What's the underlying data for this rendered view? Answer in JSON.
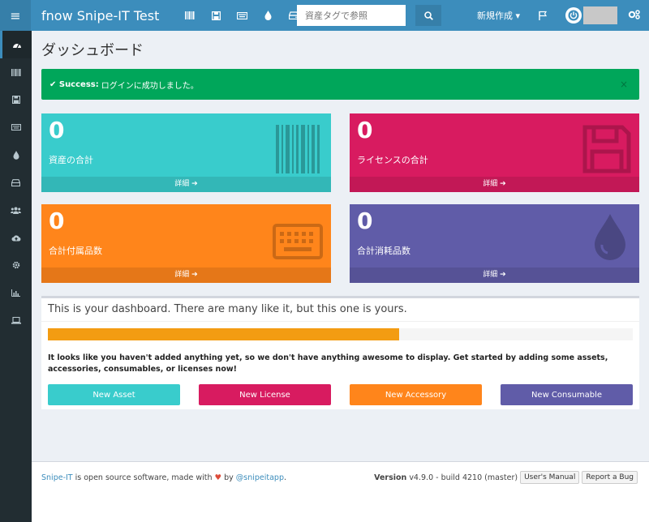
{
  "app": {
    "title": "fnow Snipe-IT Test"
  },
  "topnav": {
    "icons": [
      "barcode-icon",
      "floppy-icon",
      "keyboard-icon",
      "drop-icon",
      "hdd-icon"
    ],
    "search_placeholder": "資産タグで参照",
    "new_menu_label": "新規作成 ▾"
  },
  "page": {
    "title": "ダッシュボード"
  },
  "alert": {
    "strong": "✔ Success:",
    "message": "ログインに成功しました。",
    "close": "×"
  },
  "tiles": [
    {
      "count": "0",
      "label": "資産の合計",
      "more": "詳細 ➔",
      "color": "#39cccc",
      "icon": "barcode-icon"
    },
    {
      "count": "0",
      "label": "ライセンスの合計",
      "more": "詳細 ➔",
      "color": "#d81b60",
      "icon": "floppy-icon"
    },
    {
      "count": "0",
      "label": "合計付属品数",
      "more": "詳細 ➔",
      "color": "#ff851b",
      "icon": "keyboard-icon"
    },
    {
      "count": "0",
      "label": "合計消耗品数",
      "more": "詳細 ➔",
      "color": "#605ca8",
      "icon": "drop-icon"
    }
  ],
  "welcome": {
    "title": "This is your dashboard. There are many like it, but this one is yours.",
    "progress": 0.6,
    "message": "It looks like you haven't added anything yet, so we don't have anything awesome to display. Get started by adding some assets, accessories, consumables, or licenses now!",
    "buttons": [
      {
        "label": "New Asset",
        "color": "#39cccc"
      },
      {
        "label": "New License",
        "color": "#d81b60"
      },
      {
        "label": "New Accessory",
        "color": "#ff851b"
      },
      {
        "label": "New Consumable",
        "color": "#605ca8"
      }
    ]
  },
  "footer": {
    "product": "Snipe-IT",
    "text1": " is open source software, made with ",
    "heart": "♥",
    "text2": " by ",
    "handle": "@snipeitapp",
    "period": ".",
    "version_label": "Version",
    "version_value": " v4.9.0 - build 4210 (master)",
    "manual": "User's Manual",
    "bug": "Report a Bug"
  },
  "sidebar": {
    "items": [
      "dashboard-icon",
      "barcode-icon",
      "floppy-icon",
      "keyboard-icon",
      "drop-icon",
      "hdd-icon",
      "users-icon",
      "cloud-icon",
      "gear-icon",
      "chart-icon",
      "laptop-icon"
    ]
  },
  "colors": {
    "topbar": "#3c8dbc",
    "sidebar": "#222d32",
    "success": "#00a65a",
    "progress": "#f39c12"
  }
}
